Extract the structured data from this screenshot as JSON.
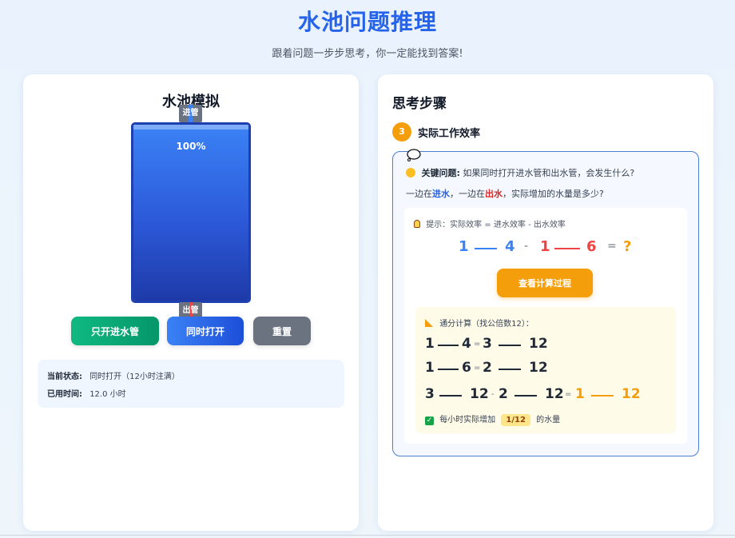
{
  "header": {
    "title": "水池问题推理",
    "subtitle": "跟着问题一步步思考，你一定能找到答案!"
  },
  "simulation": {
    "title": "水池模拟",
    "inlet_label": "进",
    "outlet_label": "出",
    "pipe_suffix": "管",
    "level": 1.0,
    "level_text": "100%",
    "buttons": {
      "inlet_only": "只开进水管",
      "both_open": "同时打开",
      "reset": "重置"
    },
    "status": {
      "state_label": "当前状态:",
      "state_value": "同时打开（12小时注满）",
      "time_label": "已用时间:",
      "time_value": "12.0 小时"
    }
  },
  "steps": {
    "title": "思考步骤",
    "current": {
      "number": "3",
      "label": "实际工作效率"
    },
    "question_icon": "thinking-face-icon",
    "question_label": "关键问题:",
    "question_text": "如果同时打开进水管和出水管，会发生什么?",
    "line2_prefix": "一边在",
    "line2_in": "进水",
    "line2_mid": "，一边在",
    "line2_out": "出水",
    "line2_suffix": "，实际增加的水量是多少?",
    "hint": "提示：实际效率 = 进水效率 - 出水效率",
    "formula": {
      "in_num": "1",
      "in_den": "4",
      "minus": "-",
      "out_num": "1",
      "out_den": "6",
      "equals": "=",
      "result": "?"
    },
    "calc_button": "查看计算过程",
    "calc": {
      "title": "通分计算（找公倍数12）：",
      "row1": {
        "a_num": "1",
        "a_den": "4",
        "eq": "=",
        "b_num": "3",
        "b_den": "12"
      },
      "row2": {
        "a_num": "1",
        "a_den": "6",
        "eq": "=",
        "b_num": "2",
        "b_den": "12"
      },
      "row3": {
        "a_num": "3",
        "a_den": "12",
        "minus": "-",
        "b_num": "2",
        "b_den": "12",
        "eq": "=",
        "r_num": "1",
        "r_den": "12"
      },
      "result_prefix": "每小时实际增加",
      "result_badge": "1/12",
      "result_suffix": "的水量"
    }
  },
  "colors": {
    "accent": "#2563eb",
    "green": "#10b981",
    "orange": "#f59e0b",
    "red": "#dc2626",
    "gray": "#6b7280"
  }
}
